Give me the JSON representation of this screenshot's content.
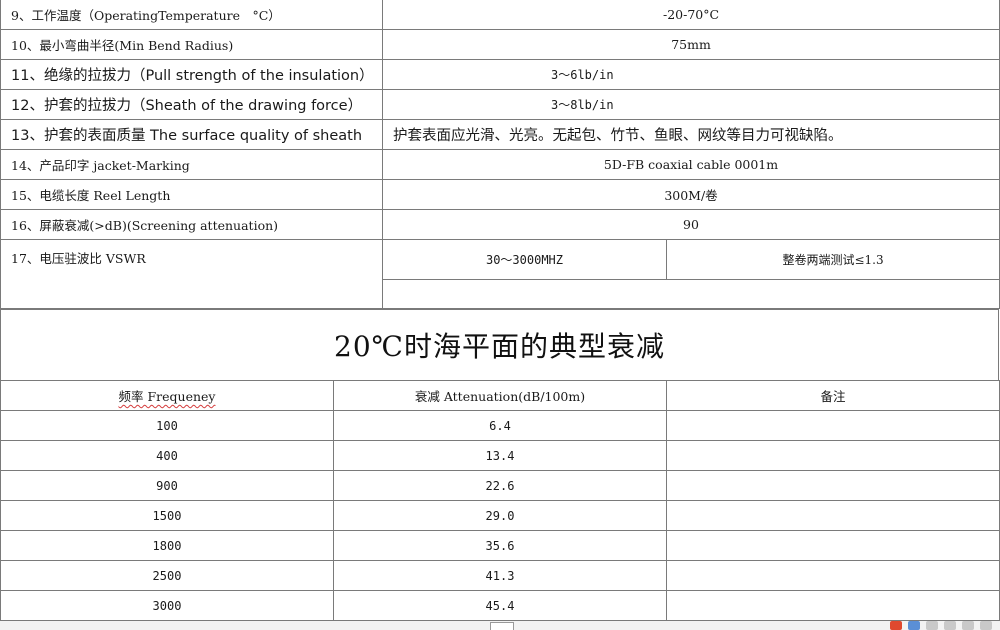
{
  "spec_rows": [
    {
      "label": "9、工作温度（OperatingTemperature　°C）",
      "value": "-20-70°C"
    },
    {
      "label": "10、最小弯曲半径(Min Bend Radius)",
      "value": "75mm"
    },
    {
      "label": "11、绝缘的拉拔力（Pull strength of the insulation）",
      "value": "3～6lb/in"
    },
    {
      "label": "12、护套的拉拔力（Sheath of the drawing force）",
      "value": "3～8lb/in"
    },
    {
      "label": "13、护套的表面质量 The surface quality of sheath",
      "value": "护套表面应光滑、光亮。无起包、竹节、鱼眼、网纹等目力可视缺陷。"
    },
    {
      "label": "14、产品印字 jacket-Marking",
      "value": "5D-FB coaxial cable 0001m"
    },
    {
      "label": "15、电缆长度 Reel Length",
      "value": "300M/卷"
    },
    {
      "label": "16、屏蔽衰减(>dB)(Screening attenuation)",
      "value": "90"
    }
  ],
  "vswr_row": {
    "label": "17、电压驻波比 VSWR",
    "range": "30～3000MHZ",
    "spec": "整卷两端测试≤1.3"
  },
  "title": "20℃时海平面的典型衰减",
  "atten_table": {
    "headers": [
      "频率 Frequeney",
      "衰减 Attenuation(dB/100m)",
      "备注"
    ],
    "rows": [
      [
        "100",
        "6.4",
        ""
      ],
      [
        "400",
        "13.4",
        ""
      ],
      [
        "900",
        "22.6",
        ""
      ],
      [
        "1500",
        "29.0",
        ""
      ],
      [
        "1800",
        "35.6",
        ""
      ],
      [
        "2500",
        "41.3",
        ""
      ],
      [
        "3000",
        "45.4",
        ""
      ]
    ]
  },
  "icons": {
    "document_tab": "document-icon",
    "tray": [
      "app-logo-icon",
      "language-icon",
      "tray-icon",
      "tray-icon",
      "tray-icon",
      "tray-icon"
    ]
  }
}
